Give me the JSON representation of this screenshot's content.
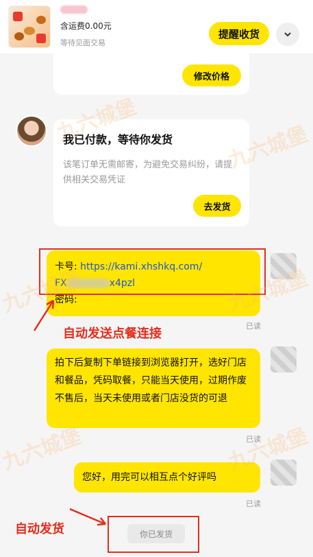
{
  "header": {
    "shipping": "含运费0.00元",
    "status_sub": "等待见面交易",
    "remind_btn": "提醒收货"
  },
  "messages": {
    "modify_price_btn": "修改价格",
    "pay_title": "我已付款，等待你发货",
    "pay_body": "该笔订单无需邮寄，为避免交易纠纷，请提供相关交易凭证",
    "ship_btn": "去发货",
    "card_label": "卡号:",
    "card_link": "https://kami.xhshkq.com/",
    "card_link_line2_start": "FX",
    "card_link_line2_end": "x4pzl",
    "password_label": "密码:",
    "read1": "已读",
    "instructions": "拍下后复制下单链接到浏览器打开，选好门店和餐品，凭码取餐，只能当天使用，过期作废不售后，当天未使用或者门店没货的可退",
    "read2": "已读",
    "review": "您好，用完可以相互点个好评吗",
    "read3": "已读",
    "shipped_status": "你已发货"
  },
  "annotations": {
    "auto_link": "自动发送点餐连接",
    "auto_ship": "自动发货"
  },
  "watermark": "九六城堡",
  "colors": {
    "accent_yellow": "#ffe500",
    "annotation_red": "#e52d1c",
    "link_blue": "#1a55d6"
  }
}
